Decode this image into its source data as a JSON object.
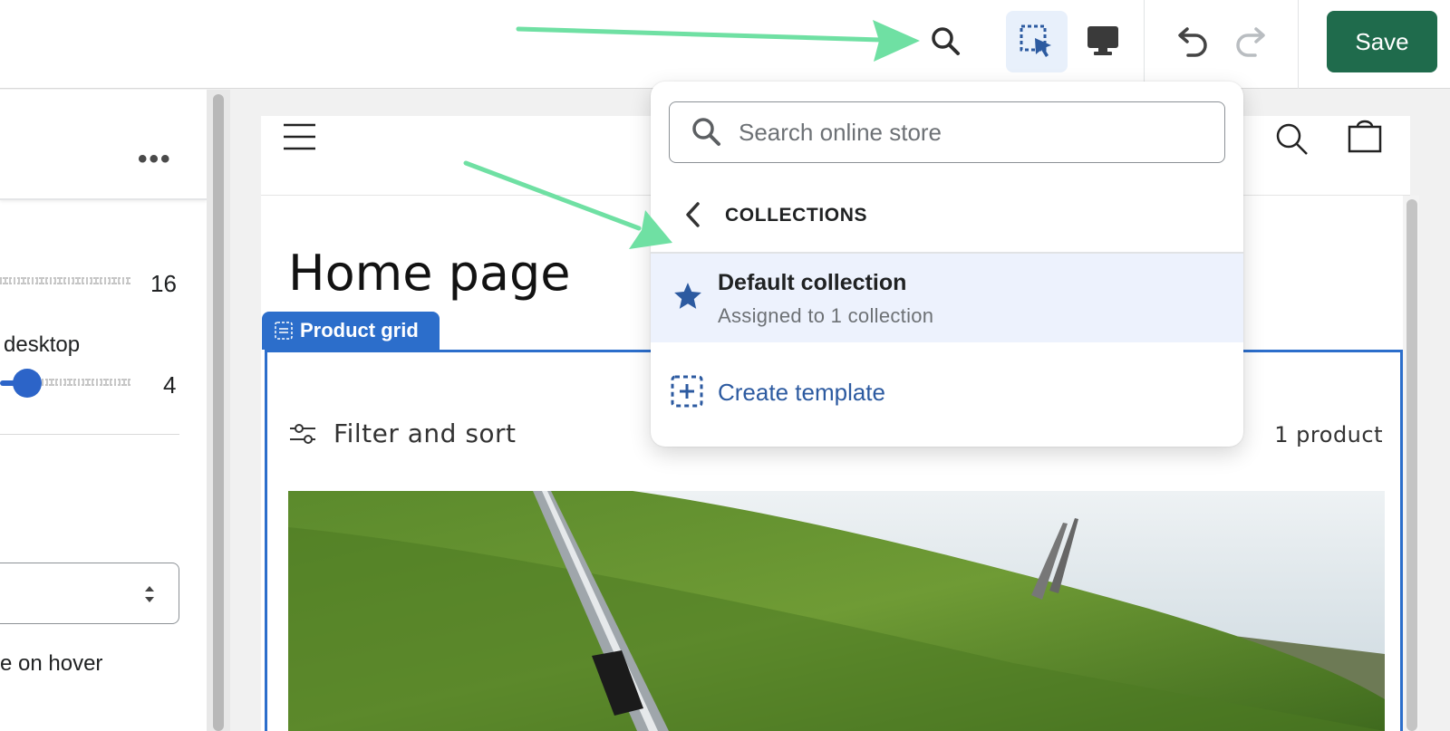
{
  "toolbar": {
    "save_label": "Save",
    "icons": [
      "search-icon",
      "select-cursor-icon",
      "desktop-icon",
      "undo-icon",
      "redo-icon"
    ]
  },
  "left_panel": {
    "slider1_value": "16",
    "slider2_label": "desktop",
    "slider2_value": "4",
    "hover_label": "e on hover"
  },
  "preview": {
    "page_title": "Home page",
    "section_tag": "Product grid",
    "filter_label": "Filter and sort",
    "product_count": "1 product"
  },
  "dropdown": {
    "search_placeholder": "Search online store",
    "section_title": "COLLECTIONS",
    "active_item": {
      "title": "Default collection",
      "subtitle": "Assigned to 1 collection"
    },
    "create_label": "Create template"
  },
  "colors": {
    "save_bg": "#1f6b4c",
    "accent_blue": "#2c6ecb",
    "highlight_bg": "#edf2fd",
    "arrow_green": "#6fe0a3"
  }
}
